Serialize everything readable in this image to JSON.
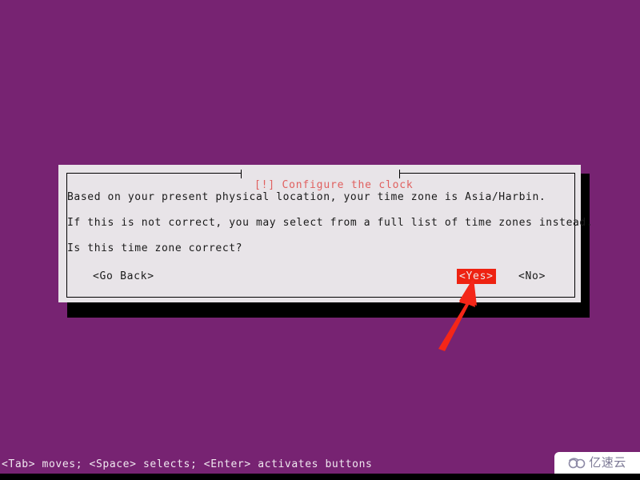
{
  "screen": {
    "background_color": "#772372",
    "bottom_strip_color": "#000000"
  },
  "dialog": {
    "title": "[!] Configure the clock",
    "title_color": "#e0605f",
    "background_color": "#e8e4e8",
    "border_color": "#000000",
    "body_lines": [
      "Based on your present physical location, your time zone is Asia/Harbin.",
      "If this is not correct, you may select from a full list of time zones instead.",
      "Is this time zone correct?"
    ],
    "buttons": {
      "go_back": "<Go Back>",
      "yes": "<Yes>",
      "no": "<No>",
      "selected": "<Yes>",
      "selected_background": "#ee2211",
      "selected_foreground": "#f2e8e8"
    }
  },
  "annotation": {
    "arrow_color": "#f42618",
    "points_to": "<Yes>"
  },
  "footer": {
    "help_text": "<Tab> moves; <Space> selects; <Enter> activates buttons",
    "text_color": "#f0e8f0"
  },
  "watermark": {
    "text": "亿速云",
    "logo_icon": "cloud-logo-icon",
    "color": "#7d7a96",
    "background": "#ffffff"
  }
}
